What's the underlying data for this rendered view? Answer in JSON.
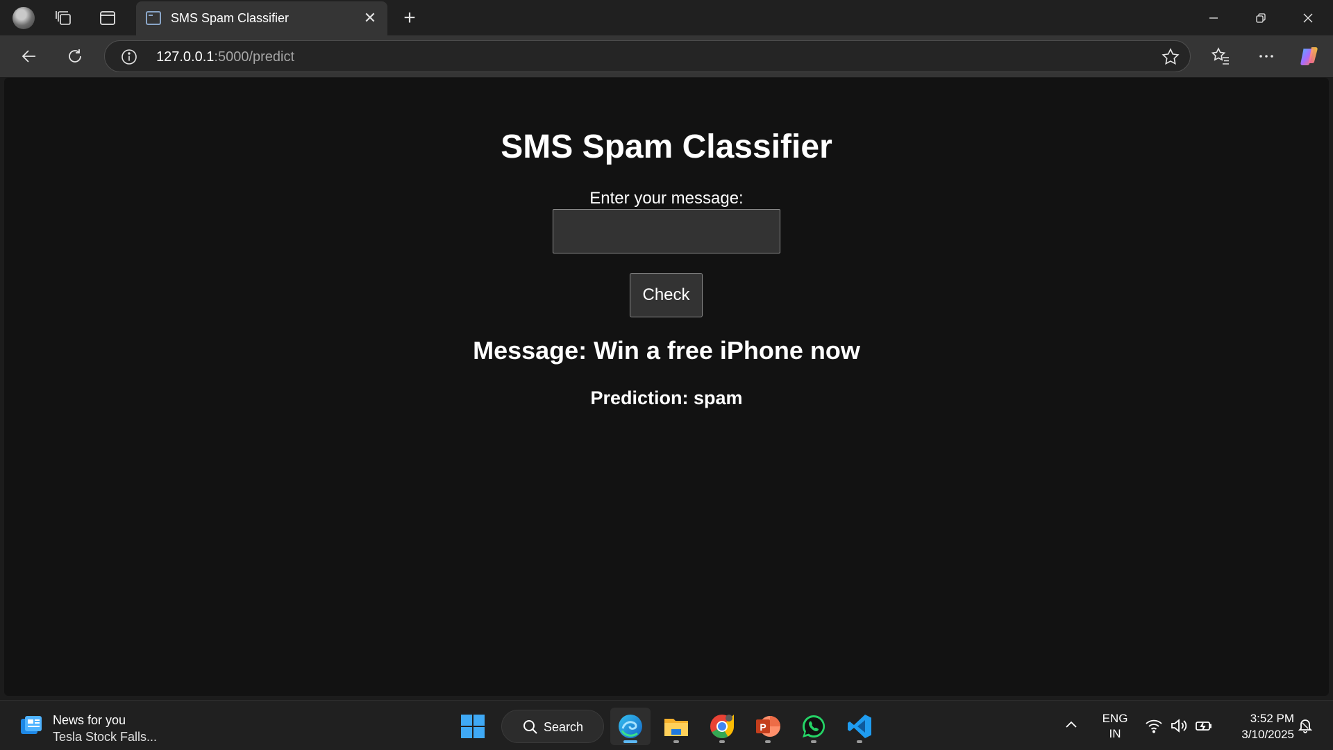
{
  "browser": {
    "tab": {
      "title": "SMS Spam Classifier"
    },
    "address": {
      "host": "127.0.0.1",
      "path": ":5000/predict"
    }
  },
  "page": {
    "heading": "SMS Spam Classifier",
    "input_label": "Enter your message:",
    "input_value": "",
    "button_label": "Check",
    "result_message": "Message: Win a free iPhone now",
    "result_prediction": "Prediction: spam"
  },
  "taskbar": {
    "news": {
      "title": "News for you",
      "headline": "Tesla Stock Falls..."
    },
    "search_label": "Search",
    "apps": [
      "edge",
      "file-explorer",
      "chrome",
      "powerpoint",
      "whatsapp",
      "vscode"
    ],
    "language": {
      "line1": "ENG",
      "line2": "IN"
    },
    "clock": {
      "time": "3:52 PM",
      "date": "3/10/2025"
    }
  },
  "colors": {
    "page_bg": "#121212",
    "chrome_bg": "#202020",
    "toolbar_bg": "#353535",
    "control_bg": "#333333",
    "accent": "#5cb8f5"
  }
}
